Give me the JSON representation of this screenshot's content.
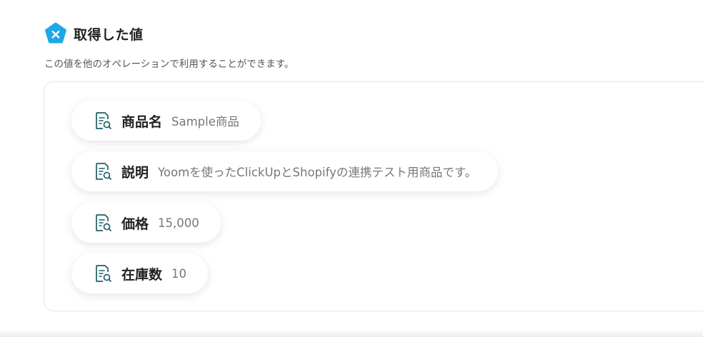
{
  "header": {
    "title": "取得した値",
    "icon": "yoom-brand-icon",
    "accent_color": "#1ea7e8"
  },
  "description": "この値を他のオペレーションで利用することができます。",
  "values": [
    {
      "key": "商品名",
      "value": "Sample商品",
      "icon": "document-search-icon"
    },
    {
      "key": "説明",
      "value": "Yoomを使ったClickUpとShopifyの連携テスト用商品です。",
      "icon": "document-search-icon"
    },
    {
      "key": "価格",
      "value": "15,000",
      "icon": "document-search-icon"
    },
    {
      "key": "在庫数",
      "value": "10",
      "icon": "document-search-icon"
    }
  ],
  "colors": {
    "icon_stroke": "#1f5f66",
    "title_text": "#222222",
    "value_text": "#777777"
  }
}
